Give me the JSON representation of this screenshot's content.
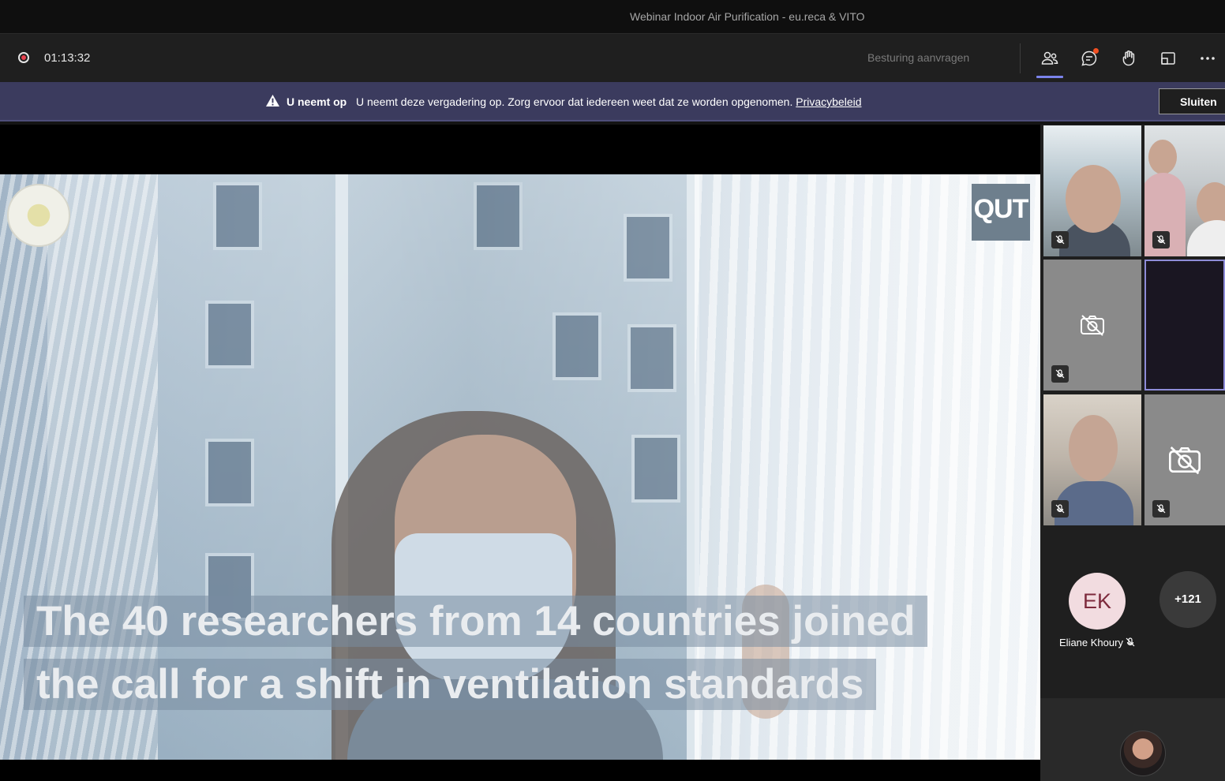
{
  "window": {
    "title": "Webinar Indoor Air Purification - eu.reca & VITO"
  },
  "toolbar": {
    "recording_time": "01:13:32",
    "request_control_label": "Besturing aanvragen",
    "icons": [
      "people-icon",
      "chat-icon",
      "raise-hand-icon",
      "share-screen-icon",
      "more-options-icon"
    ]
  },
  "banner": {
    "status_bold": "U neemt op",
    "message": "U neemt deze vergadering op. Zorg ervoor dat iedereen weet dat ze worden opgenomen.",
    "privacy_link": "Privacybeleid",
    "close_label": "Sluiten"
  },
  "video": {
    "logo_right": "QUT",
    "caption_line1": "The 40 researchers from 14 countries joined",
    "caption_line2": "the call for a shift in ventilation standards"
  },
  "participants": {
    "avatar_initials": "EK",
    "avatar_name": "Eliane Khoury",
    "overflow_count": "+121"
  },
  "colors": {
    "accent": "#7b83eb",
    "banner_bg": "#3b3b5e",
    "record_red": "#e8404e",
    "notif_orange": "#f25022"
  }
}
